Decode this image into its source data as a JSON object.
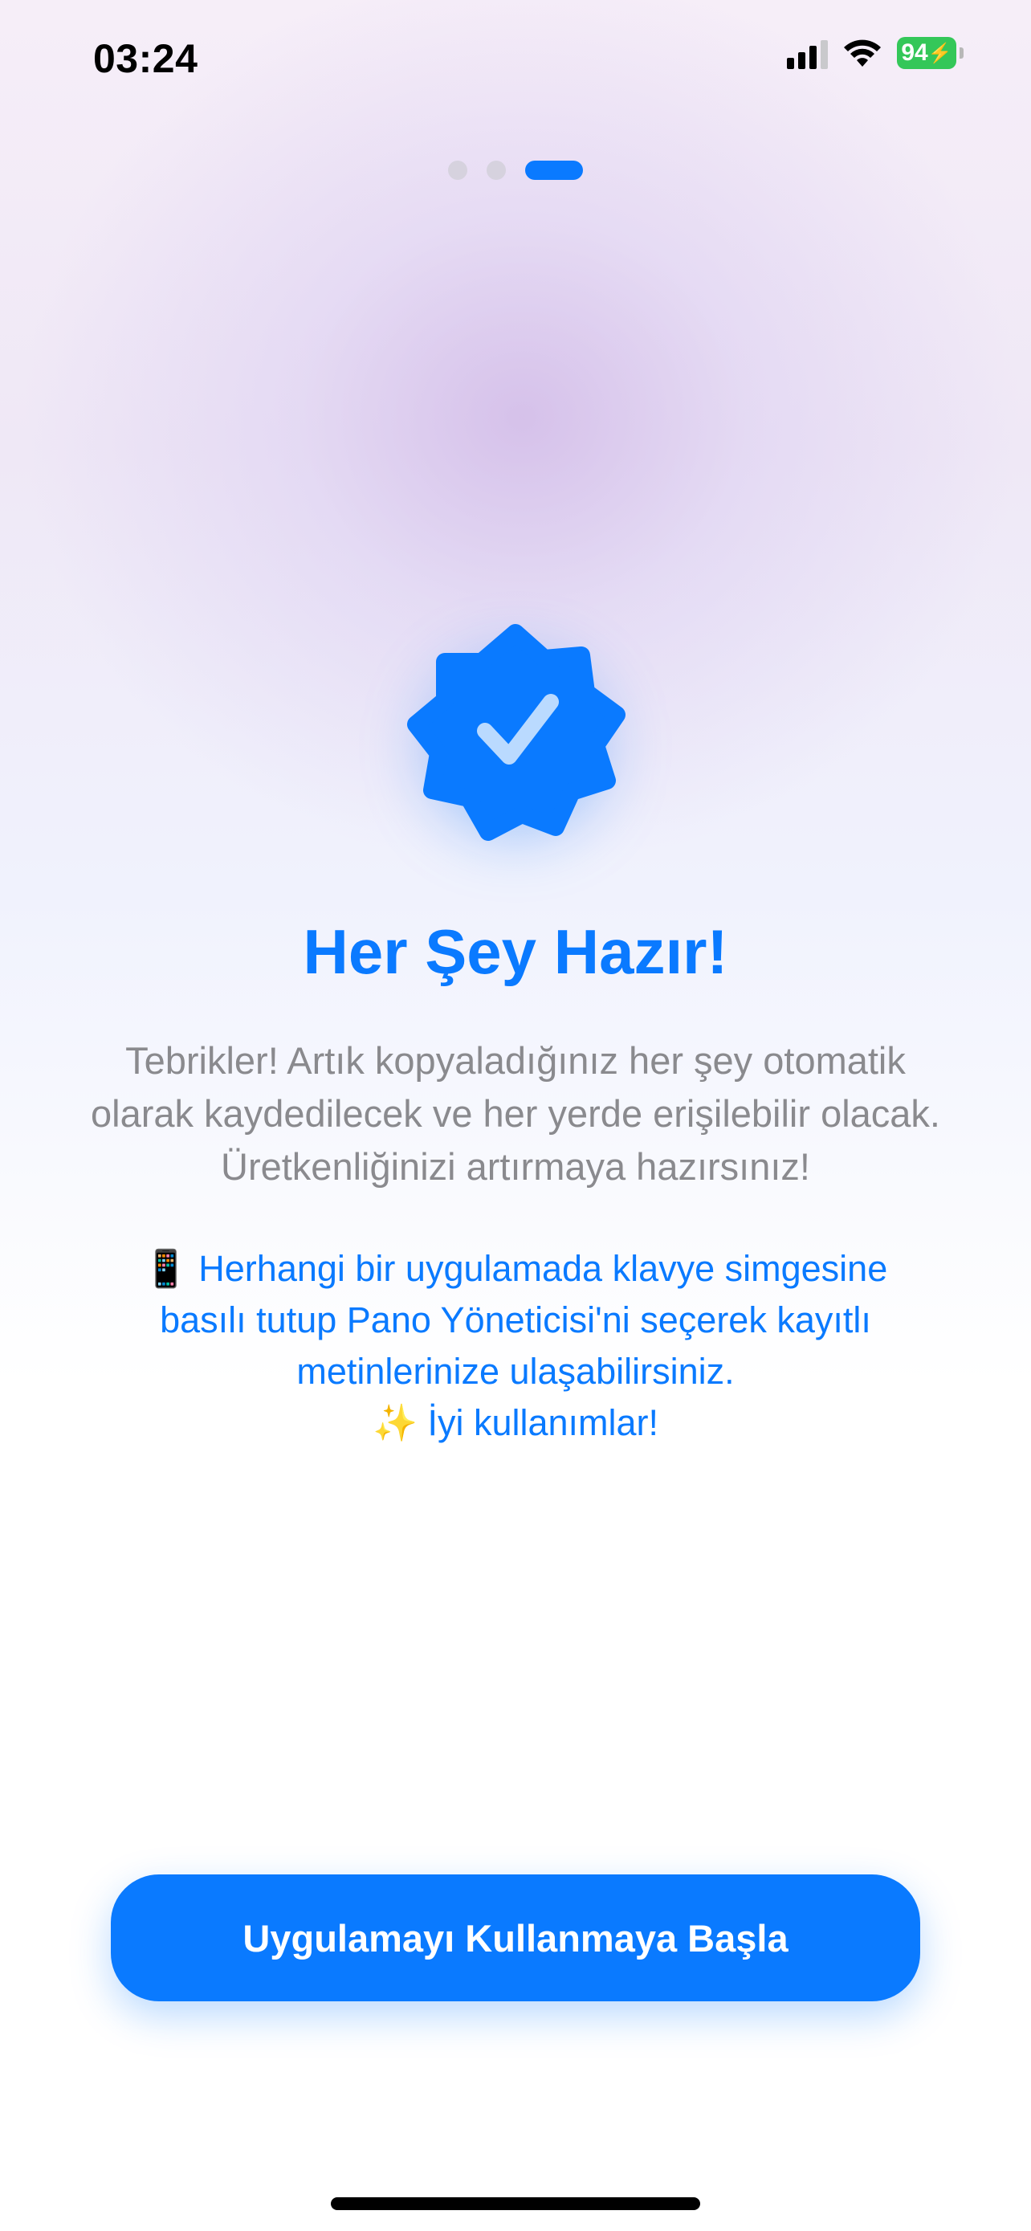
{
  "status_bar": {
    "time": "03:24",
    "battery_level": "94",
    "signal_icon": "cellular-signal-icon",
    "wifi_icon": "wifi-icon",
    "battery_icon": "battery-charging-icon"
  },
  "pager": {
    "total_pages": 3,
    "current_page": 3
  },
  "badge": {
    "icon": "checkmark-seal-icon",
    "color": "#0a7aff"
  },
  "content": {
    "title": "Her Şey Hazır!",
    "description": "Tebrikler! Artık kopyaladığınız her şey otomatik olarak kaydedilecek ve her yerde erişilebilir olacak. Üretkenliğinizi artırmaya hazırsınız!",
    "hint_line1": "📱 Herhangi bir uygulamada klavye simgesine basılı tutup Pano Yöneticisi'ni seçerek kayıtlı metinlerinize ulaşabilirsiniz.",
    "hint_line2": "✨ İyi kullanımlar!"
  },
  "cta": {
    "label": "Uygulamayı Kullanmaya Başla"
  },
  "colors": {
    "accent": "#0a7aff",
    "battery": "#34c759",
    "secondary_text": "#8a8a8e"
  }
}
